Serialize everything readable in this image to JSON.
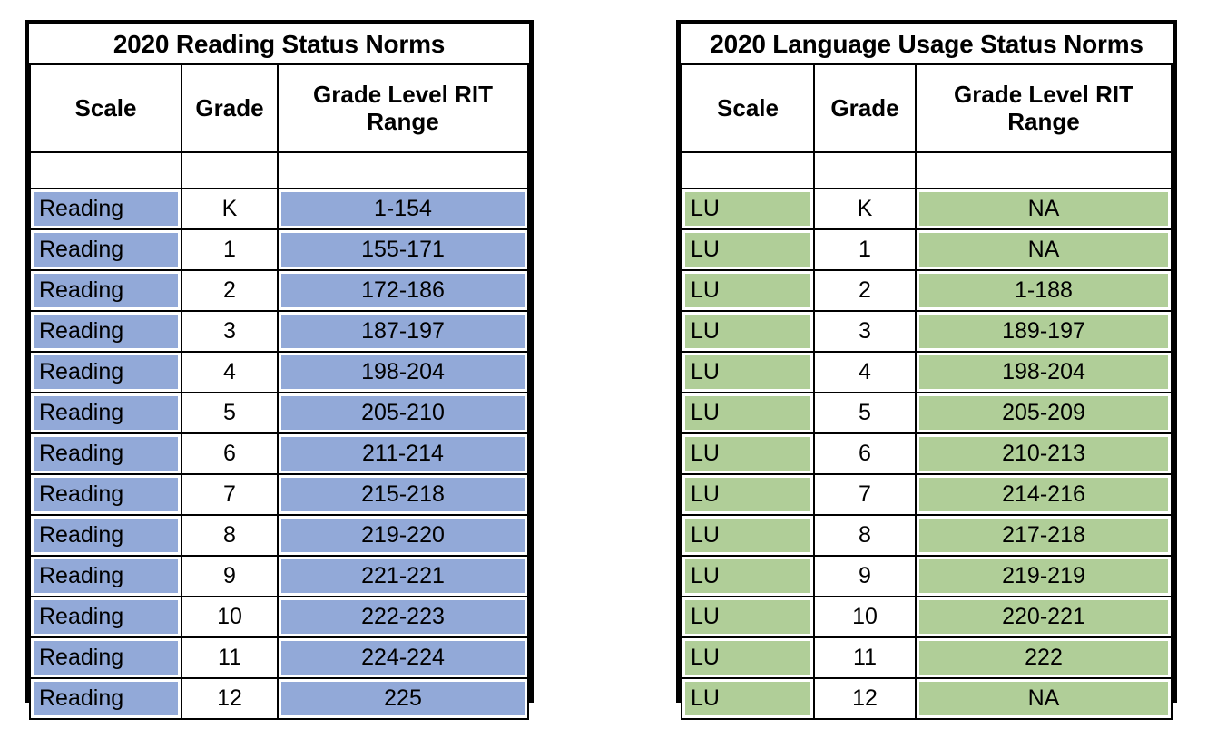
{
  "reading": {
    "title": "2020 Reading Status Norms",
    "columns": [
      "Scale",
      "Grade",
      "Grade Level RIT Range"
    ],
    "accent_color": "#92a9d8",
    "rows": [
      {
        "scale": "Reading",
        "grade": "K",
        "range": "1-154"
      },
      {
        "scale": "Reading",
        "grade": "1",
        "range": "155-171"
      },
      {
        "scale": "Reading",
        "grade": "2",
        "range": "172-186"
      },
      {
        "scale": "Reading",
        "grade": "3",
        "range": "187-197"
      },
      {
        "scale": "Reading",
        "grade": "4",
        "range": "198-204"
      },
      {
        "scale": "Reading",
        "grade": "5",
        "range": "205-210"
      },
      {
        "scale": "Reading",
        "grade": "6",
        "range": "211-214"
      },
      {
        "scale": "Reading",
        "grade": "7",
        "range": "215-218"
      },
      {
        "scale": "Reading",
        "grade": "8",
        "range": "219-220"
      },
      {
        "scale": "Reading",
        "grade": "9",
        "range": "221-221"
      },
      {
        "scale": "Reading",
        "grade": "10",
        "range": "222-223"
      },
      {
        "scale": "Reading",
        "grade": "11",
        "range": "224-224"
      },
      {
        "scale": "Reading",
        "grade": "12",
        "range": "225"
      }
    ]
  },
  "language": {
    "title": "2020 Language Usage Status Norms",
    "columns": [
      "Scale",
      "Grade",
      "Grade Level RIT Range"
    ],
    "accent_color": "#b0ce98",
    "rows": [
      {
        "scale": "LU",
        "grade": "K",
        "range": "NA"
      },
      {
        "scale": "LU",
        "grade": "1",
        "range": "NA"
      },
      {
        "scale": "LU",
        "grade": "2",
        "range": "1-188"
      },
      {
        "scale": "LU",
        "grade": "3",
        "range": "189-197"
      },
      {
        "scale": "LU",
        "grade": "4",
        "range": "198-204"
      },
      {
        "scale": "LU",
        "grade": "5",
        "range": "205-209"
      },
      {
        "scale": "LU",
        "grade": "6",
        "range": "210-213"
      },
      {
        "scale": "LU",
        "grade": "7",
        "range": "214-216"
      },
      {
        "scale": "LU",
        "grade": "8",
        "range": "217-218"
      },
      {
        "scale": "LU",
        "grade": "9",
        "range": "219-219"
      },
      {
        "scale": "LU",
        "grade": "10",
        "range": "220-221"
      },
      {
        "scale": "LU",
        "grade": "11",
        "range": "222"
      },
      {
        "scale": "LU",
        "grade": "12",
        "range": "NA"
      }
    ]
  }
}
